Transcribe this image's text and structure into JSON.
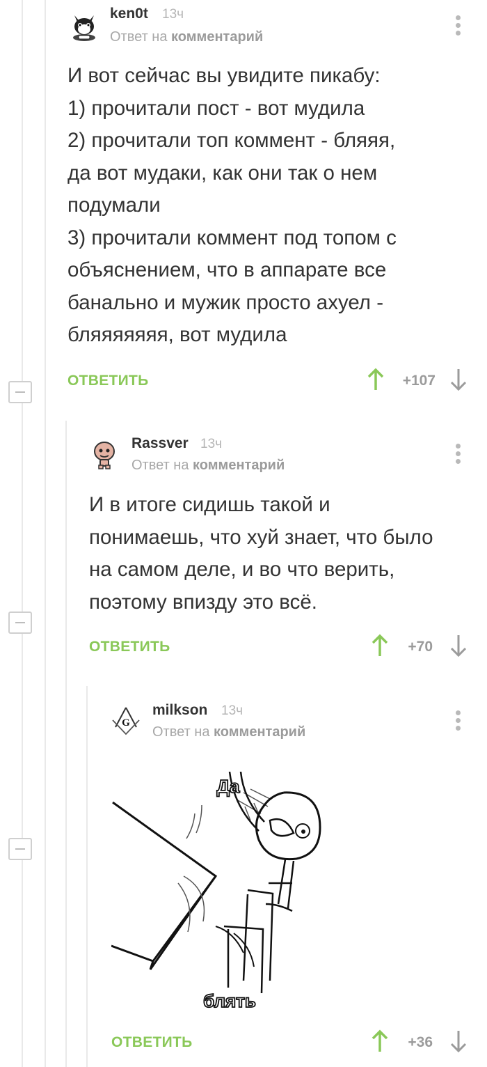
{
  "comments": [
    {
      "username": "ken0t",
      "time": "13ч",
      "reply_prefix": "Ответ на ",
      "reply_link": "комментарий",
      "text": "И вот сейчас вы увидите пикабу:\n1) прочитали пост - вот мудила\n2) прочитали топ коммент - бляяя,\nда вот мудаки, как они так о нем\nподумали\n3) прочитали коммент под топом с\nобъяснением, что в аппарате все\nбанально и мужик просто ахуел -\nбляяяяяяя, вот мудила",
      "reply_label": "ОТВЕТИТЬ",
      "rating": "+107",
      "avatar_icon": "cat-avatar-icon"
    },
    {
      "username": "Rassver",
      "time": "13ч",
      "reply_prefix": "Ответ на ",
      "reply_link": "комментарий",
      "text": "И в итоге сидишь такой и\nпонимаешь, что хуй знает, что было\nна самом деле, и во что верить,\nпоэтому впизду это всё.",
      "reply_label": "ОТВЕТИТЬ",
      "rating": "+70",
      "avatar_icon": "isaac-avatar-icon"
    },
    {
      "username": "milkson",
      "time": "13ч",
      "reply_prefix": "Ответ на ",
      "reply_link": "комментарий",
      "image_caption_top": "Да",
      "image_caption_bottom": "блять",
      "reply_label": "ОТВЕТИТЬ",
      "rating": "+36",
      "avatar_icon": "masonic-avatar-icon"
    }
  ],
  "colors": {
    "accent_green": "#8ac858",
    "muted_gray": "#9b9b9b",
    "text": "#333333"
  }
}
